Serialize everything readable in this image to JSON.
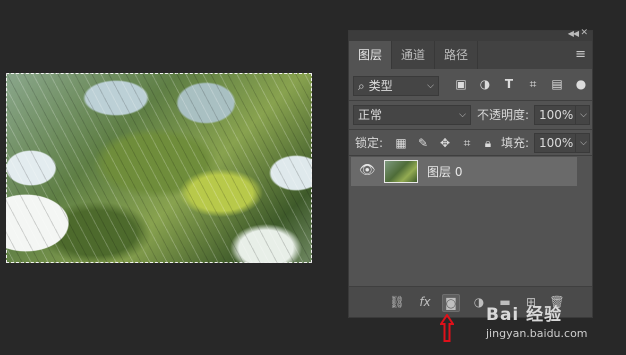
{
  "panel": {
    "tabs": [
      {
        "label": "图层",
        "active": true
      },
      {
        "label": "通道",
        "active": false
      },
      {
        "label": "路径",
        "active": false
      }
    ],
    "filter": {
      "kind_label": "类型",
      "icons": [
        "image-filter-icon",
        "adjustment-filter-icon",
        "type-filter-icon",
        "shape-filter-icon",
        "smart-object-filter-icon"
      ]
    },
    "blend_mode": "正常",
    "opacity_label": "不透明度:",
    "opacity_value": "100%",
    "lock_label": "锁定:",
    "fill_label": "填充:",
    "fill_value": "100%",
    "layers": [
      {
        "name": "图层 0",
        "visible": true,
        "selected": true
      }
    ],
    "bottom_icons": [
      "link-icon",
      "fx-icon",
      "layer-mask-icon",
      "adjustment-icon",
      "folder-icon",
      "new-layer-icon",
      "trash-icon"
    ]
  },
  "watermark": {
    "brand": "Bai 经验",
    "url": "jingyan.baidu.com"
  },
  "colors": {
    "panel_bg": "#535353",
    "selected_layer": "#6a6a6a",
    "canvas_bg": "#282828",
    "arrow": "#e0101a"
  }
}
